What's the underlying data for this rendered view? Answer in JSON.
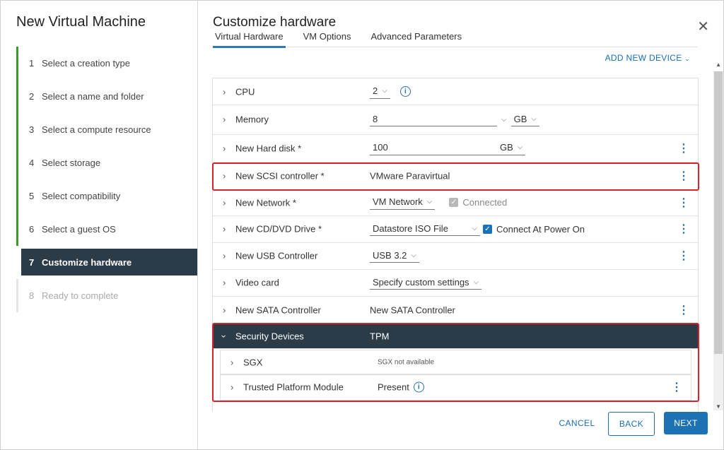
{
  "wizard": {
    "title": "New Virtual Machine",
    "steps": [
      {
        "num": "1",
        "label": "Select a creation type"
      },
      {
        "num": "2",
        "label": "Select a name and folder"
      },
      {
        "num": "3",
        "label": "Select a compute resource"
      },
      {
        "num": "4",
        "label": "Select storage"
      },
      {
        "num": "5",
        "label": "Select compatibility"
      },
      {
        "num": "6",
        "label": "Select a guest OS"
      },
      {
        "num": "7",
        "label": "Customize hardware"
      },
      {
        "num": "8",
        "label": "Ready to complete"
      }
    ]
  },
  "main": {
    "title": "Customize hardware",
    "close_glyph": "✕",
    "tabs": [
      "Virtual Hardware",
      "VM Options",
      "Advanced Parameters"
    ],
    "add_device": "ADD NEW DEVICE",
    "rows": {
      "cpu": {
        "label": "CPU",
        "value": "2"
      },
      "memory": {
        "label": "Memory",
        "value": "8",
        "unit": "GB"
      },
      "disk": {
        "label": "New Hard disk *",
        "value": "100",
        "unit": "GB"
      },
      "scsi": {
        "label": "New SCSI controller *",
        "value": "VMware Paravirtual"
      },
      "network": {
        "label": "New Network *",
        "value": "VM Network",
        "connected": "Connected"
      },
      "cddvd": {
        "label": "New CD/DVD Drive *",
        "value": "Datastore ISO File",
        "connect": "Connect At Power On"
      },
      "usb": {
        "label": "New USB Controller",
        "value": "USB 3.2"
      },
      "video": {
        "label": "Video card",
        "value": "Specify custom settings"
      },
      "sata": {
        "label": "New SATA Controller",
        "value": "New SATA Controller"
      },
      "security": {
        "label": "Security Devices",
        "value": "TPM"
      },
      "sgx": {
        "label": "SGX",
        "value": "SGX not available"
      },
      "tpm": {
        "label": "Trusted Platform Module",
        "value": "Present"
      }
    }
  },
  "footer": {
    "cancel": "CANCEL",
    "back": "BACK",
    "next": "NEXT"
  },
  "colors": {
    "accent": "#1d72b4",
    "highlight": "#d9232a",
    "done": "#3a9a29",
    "active": "#2b3b47"
  }
}
